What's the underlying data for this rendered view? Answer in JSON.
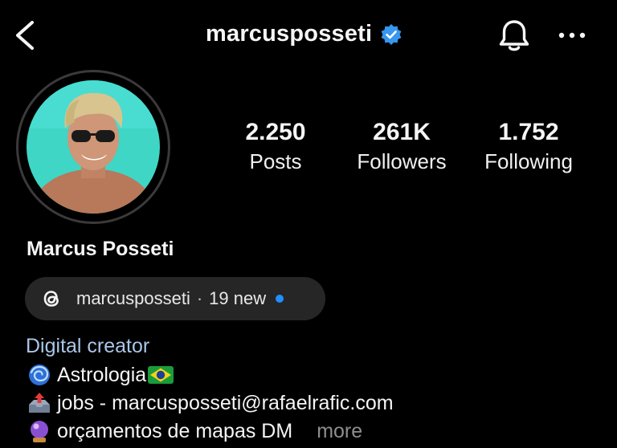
{
  "header": {
    "back_icon": "chevron-left-icon",
    "username": "marcusposseti",
    "verified_icon": "verified-badge-icon",
    "bell_icon": "bell-icon",
    "menu_icon": "more-horizontal-icon"
  },
  "profile": {
    "avatar_icon": "profile-photo",
    "display_name": "Marcus Posseti"
  },
  "stats": [
    {
      "value": "2.250",
      "label": "Posts"
    },
    {
      "value": "261K",
      "label": "Followers"
    },
    {
      "value": "1.752",
      "label": "Following"
    }
  ],
  "threads": {
    "icon": "threads-icon",
    "username": "marcusposseti",
    "separator": "·",
    "new_count": "19 new",
    "dot_color": "#1e90ff"
  },
  "bio": {
    "category": "Digital creator",
    "lines": [
      {
        "emoji": "cyclone-emoji",
        "text": "Astrologia",
        "trailing_emoji": "brazil-flag-emoji"
      },
      {
        "emoji": "outbox-tray-emoji",
        "text": " jobs - marcusposseti@rafaelrafic.com"
      },
      {
        "emoji": "crystal-ball-emoji",
        "text": "orçamentos de mapas DM"
      }
    ],
    "more_label": "more"
  },
  "colors": {
    "background": "#000000",
    "category_text": "#a9c6e8",
    "pill_background": "#262626",
    "verified_blue": "#3897f0"
  }
}
